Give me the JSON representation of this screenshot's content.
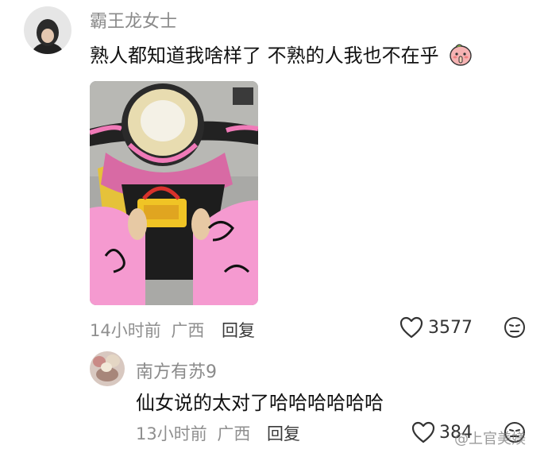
{
  "comments": [
    {
      "username": "霸王龙女士",
      "text": "熟人都知道我啥样了 不熟的人我也不在乎",
      "time": "14小时前",
      "location": "广西",
      "reply_label": "回复",
      "likes": "3577"
    },
    {
      "username": "南方有苏9",
      "text": "仙女说的太对了哈哈哈哈哈哈",
      "time": "13小时前",
      "location": "广西",
      "reply_label": "回复",
      "likes": "384"
    }
  ],
  "watermark": "@上官美媄",
  "icons": {
    "like": "heart-outline-icon",
    "dislike": "frown-face-icon",
    "emoji": "peach-shush-emoji-icon"
  },
  "colors": {
    "meta_gray": "#8f8f8f",
    "username_gray": "#8a8a8a",
    "scooter_pink": "#f07ab8"
  }
}
